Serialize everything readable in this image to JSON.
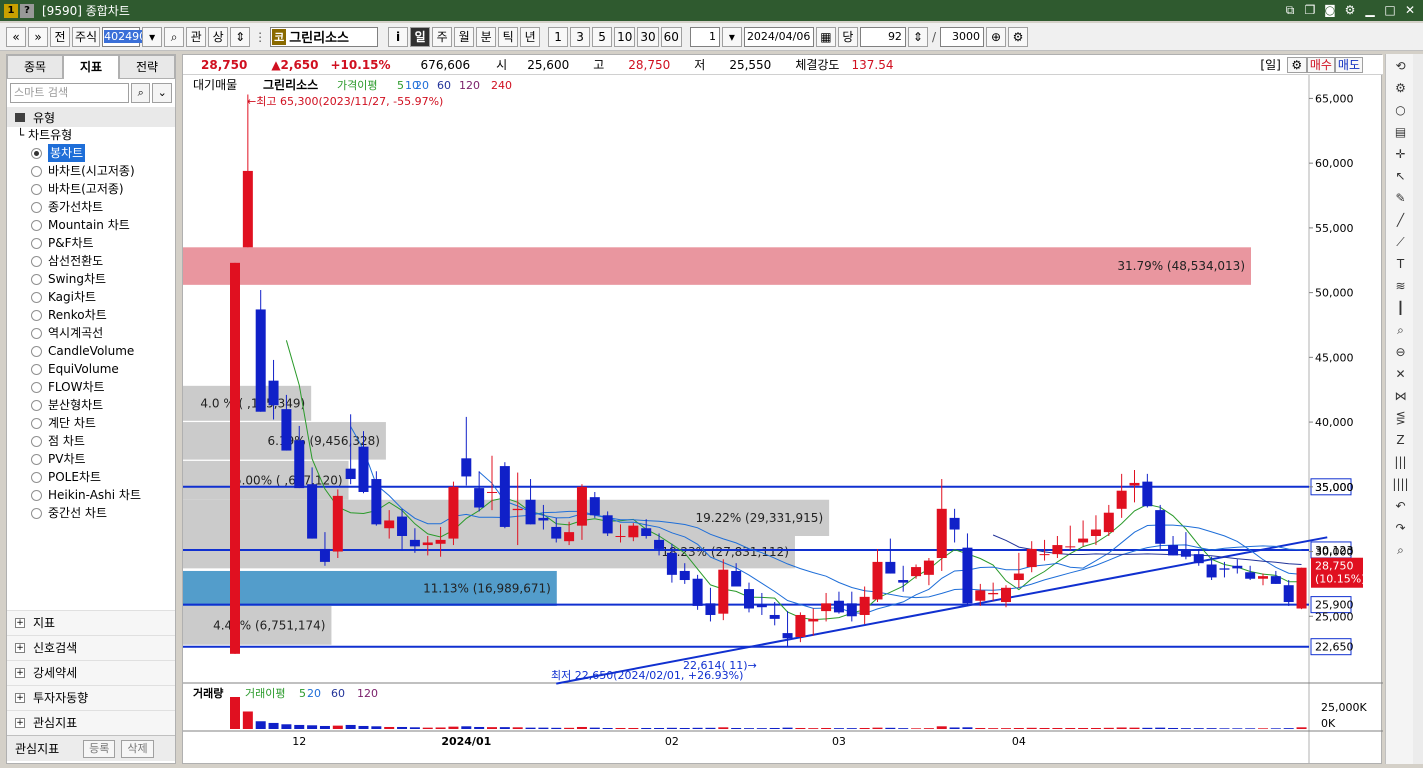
{
  "window": {
    "title": "[9590] 종합차트",
    "icon_q": "?",
    "icon_n": "1"
  },
  "toolbar": {
    "prev_label": "«",
    "next_label": "»",
    "jeon_label": "전",
    "market_label": "주식",
    "code_value": "402490",
    "gwan_label": "관",
    "sang_label": "상",
    "stock_badge": "코",
    "stock_name": "그린리소스",
    "info_label": "i",
    "periods": [
      "일",
      "주",
      "월",
      "분",
      "틱",
      "년"
    ],
    "active_period": "일",
    "intervals": [
      "1",
      "3",
      "5",
      "10",
      "30",
      "60"
    ],
    "interval_value": "1",
    "date_value": "2024/04/06",
    "dang_label": "당",
    "count_value": "92",
    "slash": "/",
    "total_value": "3000"
  },
  "left_panel": {
    "tabs": [
      "종목",
      "지표",
      "전략"
    ],
    "active_tab": "지표",
    "search_placeholder": "스마트 검색",
    "section_title": "유형",
    "subsection": "차트유형",
    "chart_types": [
      "봉차트",
      "바차트(시고저종)",
      "바차트(고저종)",
      "종가선차트",
      "Mountain 차트",
      "P&F차트",
      "삼선전환도",
      "Swing차트",
      "Kagi차트",
      "Renko차트",
      "역시계곡선",
      "CandleVolume",
      "EquiVolume",
      "FLOW차트",
      "분산형차트",
      "계단 차트",
      "점 차트",
      "PV차트",
      "POLE차트",
      "Heikin-Ashi 차트",
      "중간선 차트"
    ],
    "selected_type": "봉차트",
    "groups": [
      "지표",
      "신호검색",
      "강세약세",
      "투자자동향",
      "관심지표"
    ],
    "footer_label": "관심지표",
    "footer_register": "등록",
    "footer_delete": "삭제"
  },
  "price_bar": {
    "current": "28,750",
    "change": "▲2,650",
    "change_pct": "+10.15%",
    "volume": "676,606",
    "open_label": "시",
    "open": "25,600",
    "high_label": "고",
    "high": "28,750",
    "low_label": "저",
    "low": "25,550",
    "strength_label": "체결강도",
    "strength": "137.54",
    "period_tag": "[일]",
    "buy_label": "매수",
    "sell_label": "매도"
  },
  "chart_legend": {
    "items": [
      "대기매물",
      "그린리소스",
      "가격이평",
      "5",
      "10",
      "20",
      "60",
      "120",
      "240"
    ],
    "colors": {
      "ma5": "#2a9a2a",
      "ma10": "#1e6ed8",
      "ma20": "#1e6ed8",
      "ma60": "#223399",
      "ma120": "#7a1f6a",
      "ma240": "#d01020"
    }
  },
  "volume_legend": {
    "items": [
      "거래량",
      "거래이평",
      "5",
      "20",
      "60",
      "120"
    ]
  },
  "annotations": {
    "high_note": "←최고 65,300(2023/11/27, -55.97%)",
    "low_note": "최저 22,650(2024/02/01, +26.93%)",
    "trend_note": "22,614( 11)→"
  },
  "chart_data": {
    "type": "candlestick",
    "price_axis": {
      "min": 20000,
      "max": 66500,
      "ticks": [
        25000,
        30000,
        35000,
        40000,
        45000,
        50000,
        55000,
        60000,
        65000
      ],
      "tick_labels": [
        "25,000",
        "30,000",
        "35,000",
        "40,000",
        "45,000",
        "50,000",
        "55,000",
        "60,000",
        "65,000"
      ]
    },
    "x_labels": [
      "12",
      "2024/01",
      "02",
      "03",
      "04"
    ],
    "x_label_index": [
      5,
      18,
      34,
      47,
      61
    ],
    "candles": [
      [
        22100,
        52300,
        22100,
        52300
      ],
      [
        53500,
        65300,
        53500,
        59400
      ],
      [
        48700,
        50200,
        40800,
        40800
      ],
      [
        43200,
        44800,
        40200,
        41300
      ],
      [
        41000,
        42100,
        37800,
        37800
      ],
      [
        38600,
        39700,
        34900,
        34900
      ],
      [
        35200,
        36500,
        31000,
        31000
      ],
      [
        30200,
        31500,
        28900,
        29200
      ],
      [
        30000,
        34800,
        29500,
        34300
      ],
      [
        36400,
        40600,
        35200,
        35600
      ],
      [
        38100,
        39300,
        34500,
        34600
      ],
      [
        35600,
        36200,
        32000,
        32100
      ],
      [
        31800,
        33200,
        31000,
        32400
      ],
      [
        32700,
        33300,
        30100,
        31200
      ],
      [
        30900,
        31800,
        29900,
        30400
      ],
      [
        30500,
        31200,
        29700,
        30700
      ],
      [
        30600,
        31900,
        29600,
        30900
      ],
      [
        31000,
        35400,
        30500,
        35000
      ],
      [
        37200,
        40400,
        35100,
        35800
      ],
      [
        34900,
        36200,
        33100,
        33400
      ],
      [
        34600,
        37400,
        33200,
        34600
      ],
      [
        36600,
        36900,
        31800,
        31900
      ],
      [
        33200,
        36100,
        30500,
        33300
      ],
      [
        34000,
        35600,
        32100,
        32100
      ],
      [
        32600,
        33600,
        31700,
        32400
      ],
      [
        31900,
        32600,
        30700,
        31000
      ],
      [
        30800,
        32300,
        30500,
        31500
      ],
      [
        32000,
        35200,
        30900,
        35000
      ],
      [
        34200,
        34600,
        32600,
        32800
      ],
      [
        32800,
        33100,
        31200,
        31400
      ],
      [
        31200,
        32100,
        30700,
        31200
      ],
      [
        31100,
        32200,
        30800,
        32000
      ],
      [
        31800,
        32500,
        31000,
        31200
      ],
      [
        30900,
        31400,
        29700,
        30200
      ],
      [
        29900,
        30600,
        27600,
        28200
      ],
      [
        28500,
        29100,
        27500,
        27800
      ],
      [
        27900,
        28200,
        25500,
        25800
      ],
      [
        26000,
        27200,
        24600,
        25100
      ],
      [
        25200,
        29400,
        24700,
        28600
      ],
      [
        28500,
        29100,
        27300,
        27300
      ],
      [
        27100,
        27600,
        25300,
        25600
      ],
      [
        25900,
        26800,
        25100,
        25700
      ],
      [
        25100,
        26100,
        24300,
        24800
      ],
      [
        23700,
        25400,
        22650,
        23300
      ],
      [
        23400,
        25300,
        23000,
        25100
      ],
      [
        24600,
        25600,
        23500,
        24800
      ],
      [
        25400,
        26800,
        24600,
        26000
      ],
      [
        26200,
        26900,
        25200,
        25300
      ],
      [
        26000,
        26900,
        24600,
        25000
      ],
      [
        25100,
        27300,
        24400,
        26500
      ],
      [
        26300,
        30200,
        26100,
        29200
      ],
      [
        29200,
        31000,
        28300,
        28300
      ],
      [
        27800,
        28900,
        26900,
        27600
      ],
      [
        28100,
        29000,
        27900,
        28800
      ],
      [
        28200,
        29500,
        27400,
        29300
      ],
      [
        29500,
        35600,
        28500,
        33300
      ],
      [
        32600,
        33300,
        30700,
        31700
      ],
      [
        30300,
        31400,
        25800,
        26000
      ],
      [
        26200,
        27500,
        25800,
        27000
      ],
      [
        26700,
        27600,
        26200,
        26800
      ],
      [
        26100,
        27400,
        25700,
        27200
      ],
      [
        27800,
        29900,
        27200,
        28300
      ],
      [
        28800,
        30800,
        28400,
        30200
      ],
      [
        29800,
        30900,
        29300,
        29800
      ],
      [
        29800,
        31200,
        29500,
        30500
      ],
      [
        30400,
        32000,
        30100,
        30400
      ],
      [
        30700,
        32400,
        30400,
        31000
      ],
      [
        31200,
        32800,
        30500,
        31700
      ],
      [
        31500,
        33600,
        31200,
        33000
      ],
      [
        33300,
        36000,
        32600,
        34700
      ],
      [
        35100,
        36300,
        33800,
        35300
      ],
      [
        35400,
        36000,
        33400,
        33500
      ],
      [
        33200,
        33600,
        30200,
        30600
      ],
      [
        30500,
        31200,
        29700,
        29700
      ],
      [
        30100,
        31500,
        29400,
        29600
      ],
      [
        29800,
        30200,
        28900,
        29100
      ],
      [
        29000,
        29600,
        27800,
        28000
      ],
      [
        28700,
        29200,
        28000,
        28600
      ],
      [
        28900,
        29400,
        28300,
        28700
      ],
      [
        28400,
        28900,
        27800,
        27900
      ],
      [
        27900,
        28300,
        27400,
        28100
      ],
      [
        28100,
        28500,
        27500,
        27500
      ],
      [
        27400,
        27800,
        25800,
        26100
      ],
      [
        25600,
        28750,
        25550,
        28750
      ]
    ],
    "volume_bars": [
      950,
      520,
      230,
      180,
      140,
      120,
      110,
      90,
      100,
      120,
      90,
      80,
      60,
      60,
      50,
      40,
      45,
      70,
      80,
      60,
      55,
      55,
      50,
      40,
      40,
      35,
      35,
      60,
      40,
      30,
      30,
      30,
      30,
      30,
      35,
      30,
      35,
      35,
      50,
      30,
      25,
      25,
      30,
      40,
      30,
      25,
      30,
      25,
      25,
      30,
      40,
      35,
      25,
      20,
      25,
      80,
      45,
      50,
      30,
      25,
      25,
      30,
      35,
      30,
      30,
      30,
      30,
      30,
      35,
      45,
      40,
      35,
      40,
      30,
      25,
      25,
      25,
      20,
      20,
      20,
      20,
      20,
      25,
      50
    ],
    "volume_axis": {
      "ticks": [
        "25,000K",
        "0K"
      ]
    },
    "volume_profile": [
      {
        "label": "31.79% (48,534,013)",
        "price_low": 50600,
        "price_high": 53500,
        "length": 1.0,
        "color": "#e8909a"
      },
      {
        "label": "4.0 % ( ,125,349)",
        "price_low": 40100,
        "price_high": 42800,
        "length": 0.12,
        "color": "#c8c8c8"
      },
      {
        "label": "6.19% (9,456,328)",
        "price_low": 37100,
        "price_high": 40000,
        "length": 0.19,
        "color": "#c8c8c8"
      },
      {
        "label": "5.00% ( ,627,120)",
        "price_low": 34000,
        "price_high": 37000,
        "length": 0.155,
        "color": "#c8c8c8"
      },
      {
        "label": "19.22% (29,331,915)",
        "price_low": 31200,
        "price_high": 34000,
        "length": 0.605,
        "color": "#c8c8c8"
      },
      {
        "label": "18.23% (27,831,112)",
        "price_low": 28700,
        "price_high": 31200,
        "length": 0.573,
        "color": "#c8c8c8"
      },
      {
        "label": "11.13% (16,989,671)",
        "price_low": 25800,
        "price_high": 28500,
        "length": 0.35,
        "color": "#4a98c8"
      },
      {
        "label": "4.42% (6,751,174)",
        "price_low": 22800,
        "price_high": 25800,
        "length": 0.139,
        "color": "#c8c8c8"
      }
    ],
    "horizontal_lines": [
      {
        "price": 35000,
        "label": "35,000"
      },
      {
        "price": 30123,
        "label": "30,123"
      },
      {
        "price": 25900,
        "label": "25,900"
      },
      {
        "price": 22650,
        "label": "22,650"
      }
    ],
    "current_price_label": "28,750",
    "current_change_label": "(10.15%)",
    "trend_line": {
      "from_index": 25,
      "from_price": 19800,
      "to_index": 85,
      "to_price": 31100
    }
  }
}
